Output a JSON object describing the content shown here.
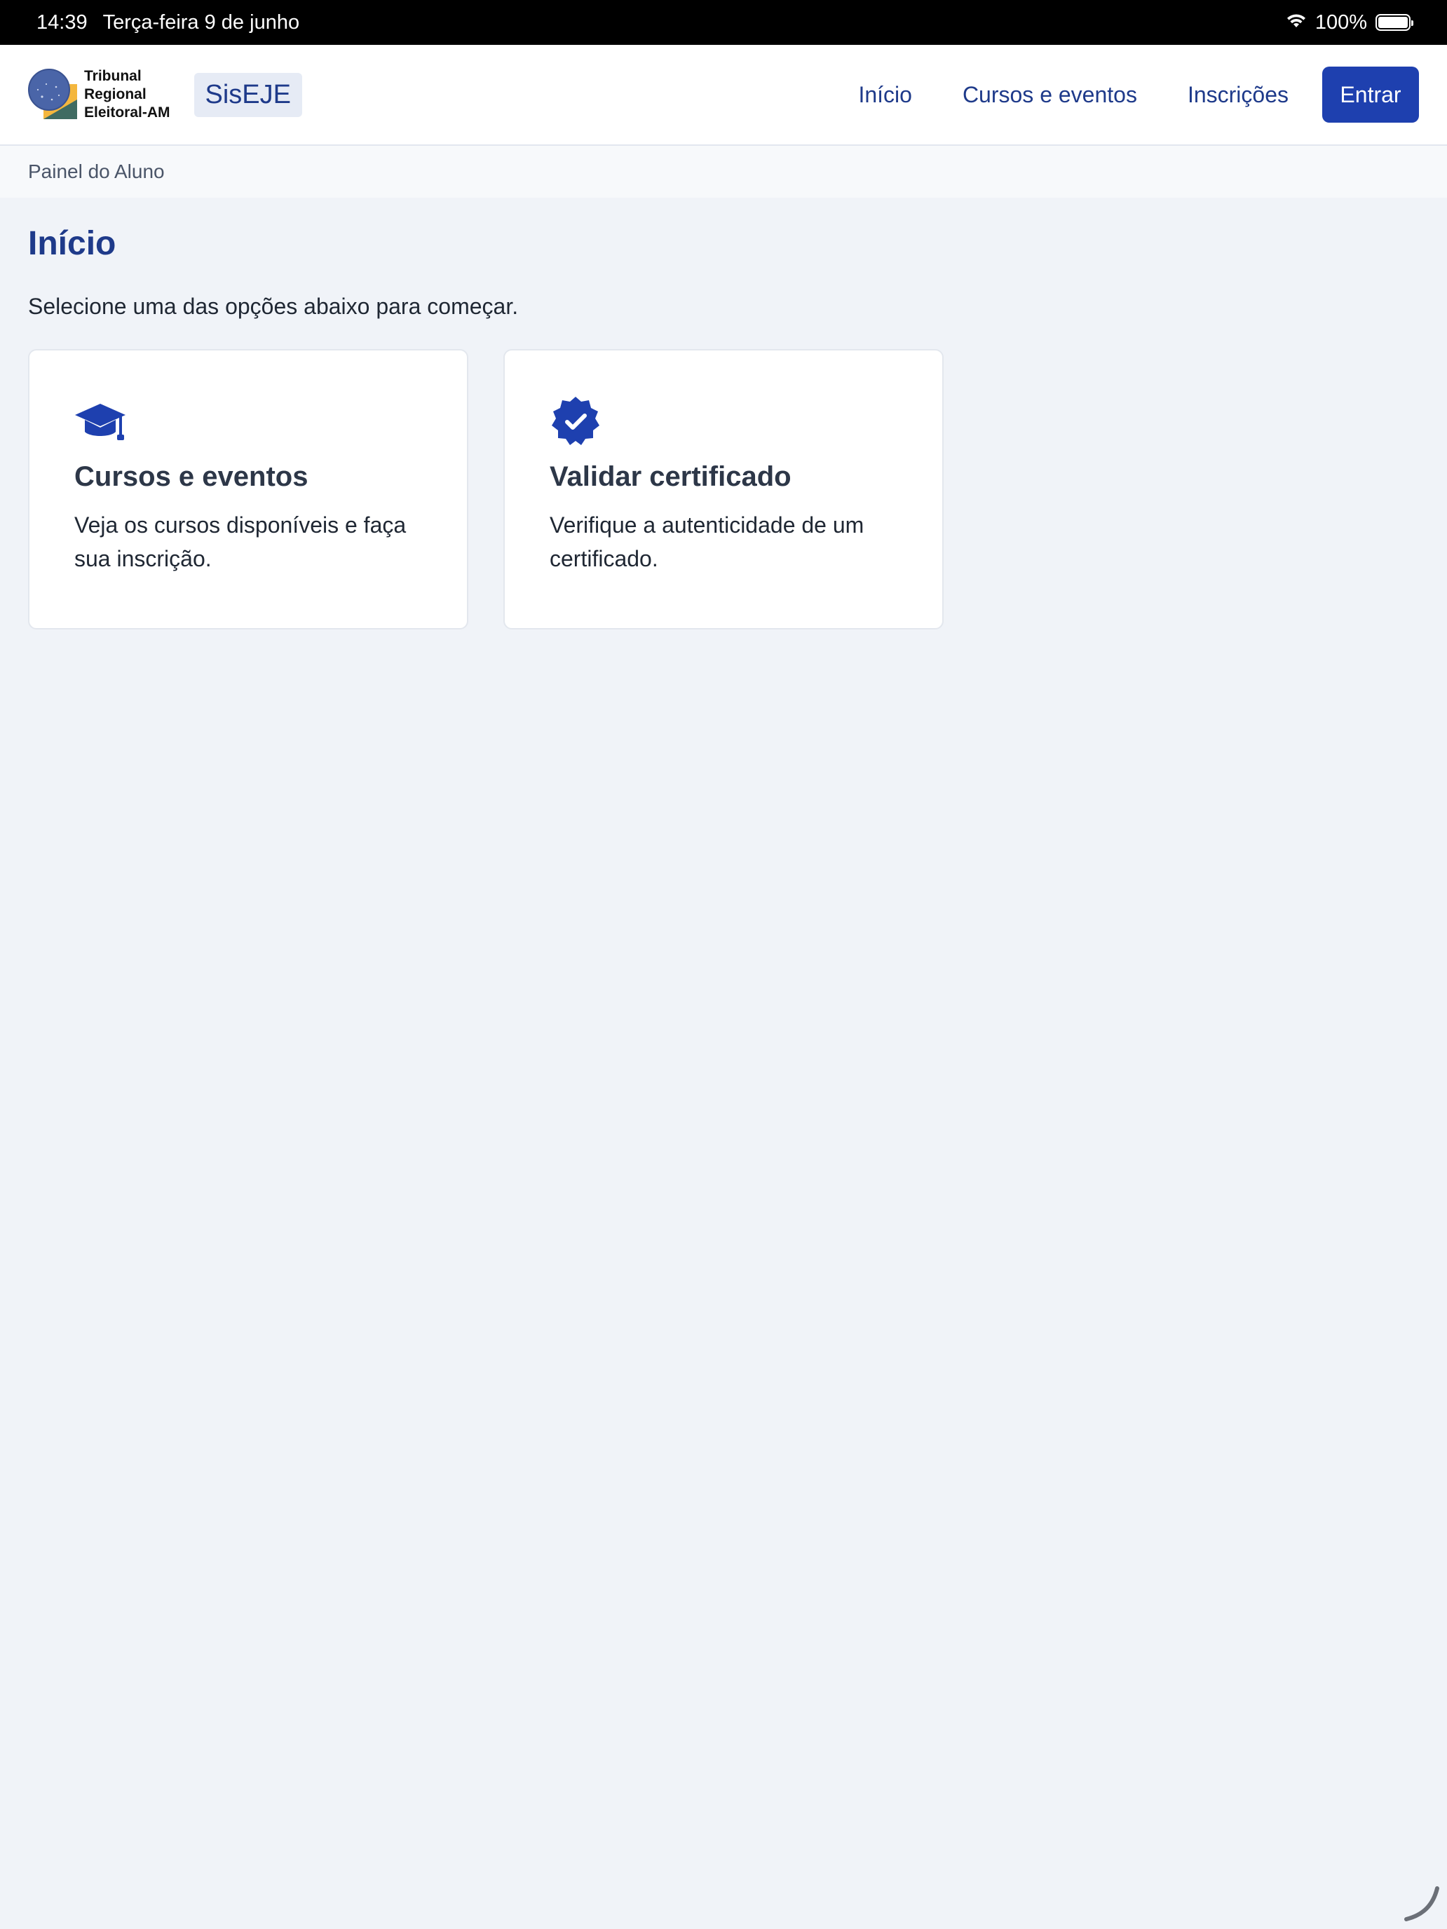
{
  "status_bar": {
    "time": "14:39",
    "date": "Terça-feira 9 de junho",
    "battery": "100%",
    "icons": [
      "wifi-icon",
      "battery-icon"
    ]
  },
  "header": {
    "logo_lines": [
      "Tribunal",
      "Regional",
      "Eleitoral-AM"
    ],
    "app_name": "SisEJE",
    "nav": {
      "inicio": "Início",
      "cursos": "Cursos e eventos",
      "inscricoes": "Inscrições"
    },
    "login_button": "Entrar"
  },
  "breadcrumb": "Painel do Aluno",
  "main": {
    "title": "Início",
    "subtitle": "Selecione uma das opções abaixo para começar.",
    "cards": [
      {
        "icon": "graduation-cap-icon",
        "title": "Cursos e eventos",
        "description": "Veja os cursos disponíveis e faça sua inscrição."
      },
      {
        "icon": "verified-badge-icon",
        "title": "Validar certificado",
        "description": "Verifique a autenticidade de um certificado."
      }
    ]
  },
  "colors": {
    "primary": "#1e40af",
    "heading": "#1e3a8a",
    "background": "#f0f3f8"
  }
}
